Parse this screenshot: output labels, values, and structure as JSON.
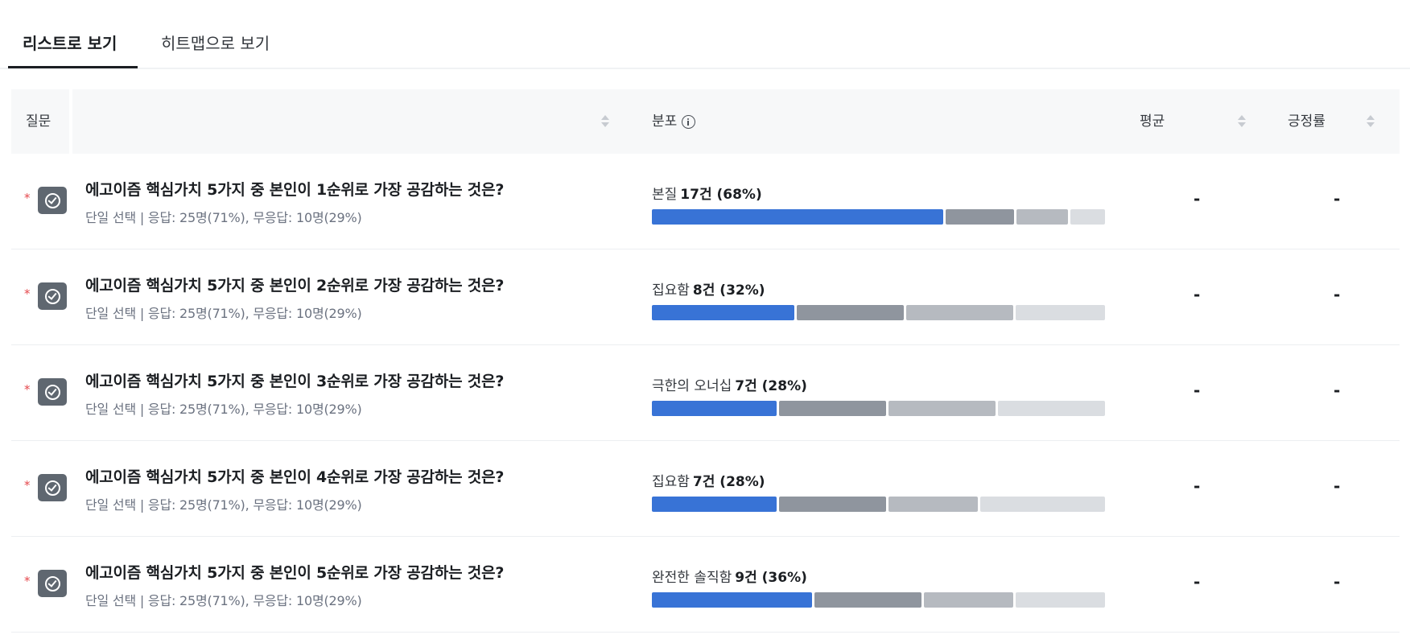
{
  "tabs": [
    {
      "label": "리스트로 보기",
      "active": true
    },
    {
      "label": "히트맵으로 보기",
      "active": false
    }
  ],
  "columns": {
    "question": "질문",
    "distribution": "분포",
    "average": "평균",
    "positive_rate": "긍정률"
  },
  "colors": {
    "segments": [
      "#3873d6",
      "#8f959e",
      "#b6bac0",
      "#dadde1"
    ],
    "required": "#e5484d",
    "icon_bg": "#5f6770"
  },
  "rows": [
    {
      "required": "*",
      "icon": "check-circle-icon",
      "title": "에고이즘 핵심가치 5가지 중 본인이 1순위로 가장 공감하는 것은?",
      "meta": "단일 선택 | 응답: 25명(71%), 무응답: 10명(29%)",
      "top_label": "본질",
      "top_count": "17건 (68%)",
      "segments": [
        17,
        4,
        3,
        2
      ],
      "average": "-",
      "positive_rate": "-"
    },
    {
      "required": "*",
      "icon": "check-circle-icon",
      "title": "에고이즘 핵심가치 5가지 중 본인이 2순위로 가장 공감하는 것은?",
      "meta": "단일 선택 | 응답: 25명(71%), 무응답: 10명(29%)",
      "top_label": "집요함",
      "top_count": "8건 (32%)",
      "segments": [
        8,
        6,
        6,
        5
      ],
      "average": "-",
      "positive_rate": "-"
    },
    {
      "required": "*",
      "icon": "check-circle-icon",
      "title": "에고이즘 핵심가치 5가지 중 본인이 3순위로 가장 공감하는 것은?",
      "meta": "단일 선택 | 응답: 25명(71%), 무응답: 10명(29%)",
      "top_label": "극한의 오너십",
      "top_count": "7건 (28%)",
      "segments": [
        7,
        6,
        6,
        6
      ],
      "average": "-",
      "positive_rate": "-"
    },
    {
      "required": "*",
      "icon": "check-circle-icon",
      "title": "에고이즘 핵심가치 5가지 중 본인이 4순위로 가장 공감하는 것은?",
      "meta": "단일 선택 | 응답: 25명(71%), 무응답: 10명(29%)",
      "top_label": "집요함",
      "top_count": "7건 (28%)",
      "segments": [
        7,
        6,
        5,
        7
      ],
      "average": "-",
      "positive_rate": "-"
    },
    {
      "required": "*",
      "icon": "check-circle-icon",
      "title": "에고이즘 핵심가치 5가지 중 본인이 5순위로 가장 공감하는 것은?",
      "meta": "단일 선택 | 응답: 25명(71%), 무응답: 10명(29%)",
      "top_label": "완전한 솔직함",
      "top_count": "9건 (36%)",
      "segments": [
        9,
        6,
        5,
        5
      ],
      "average": "-",
      "positive_rate": "-"
    }
  ]
}
